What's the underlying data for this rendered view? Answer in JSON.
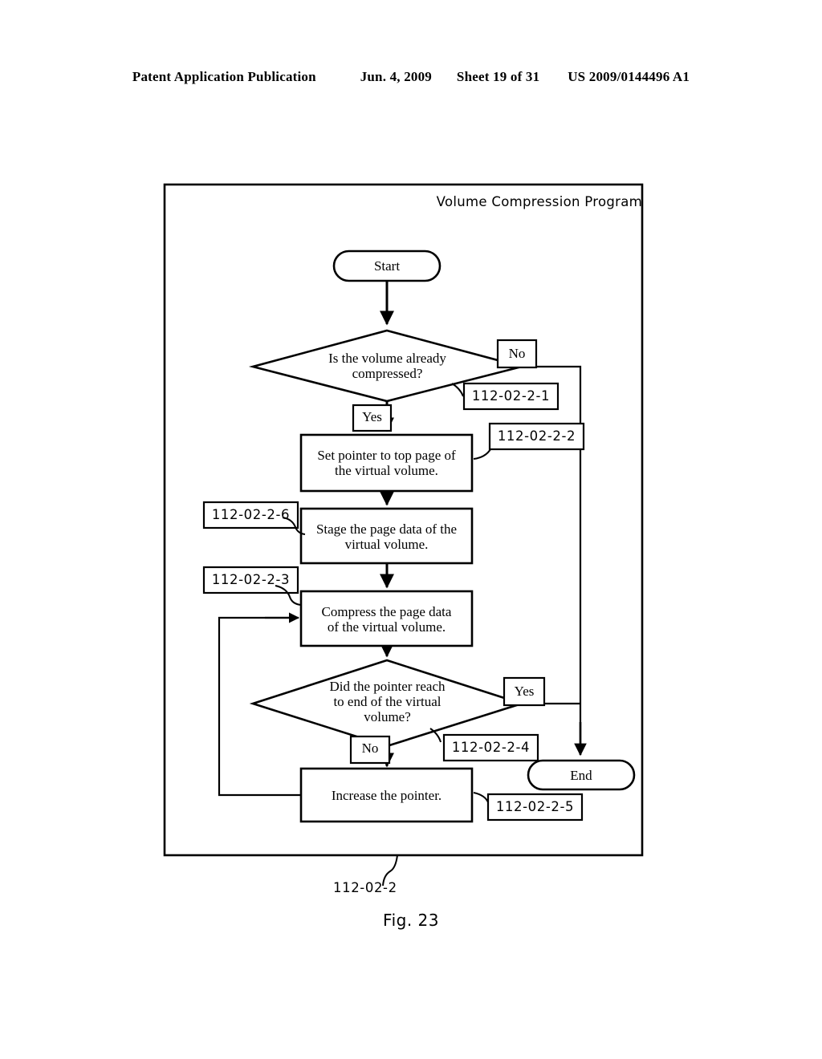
{
  "header": {
    "publication": "Patent Application Publication",
    "date": "Jun. 4, 2009",
    "sheet": "Sheet 19 of 31",
    "docnumber": "US 2009/0144496 A1"
  },
  "figure": {
    "caption": "Fig. 23",
    "container_title": "Volume Compression Program",
    "container_ref": "112-02-2"
  },
  "flow": {
    "start": "Start",
    "end": "End",
    "decision1": "Is the volume already\ncompressed?",
    "decision1_yes": "Yes",
    "decision1_no": "No",
    "decision1_ref": "112-02-2-1",
    "step_set_pointer": "Set pointer to top page of\nthe virtual volume.",
    "step_set_pointer_ref": "112-02-2-2",
    "step_stage": "Stage the page data of the\nvirtual volume.",
    "step_stage_ref": "112-02-2-6",
    "step_compress": "Compress the page data\nof the virtual volume.",
    "step_compress_ref": "112-02-2-3",
    "decision2": "Did the pointer reach\nto end of the virtual\nvolume?",
    "decision2_yes": "Yes",
    "decision2_no": "No",
    "decision2_ref": "112-02-2-4",
    "step_increase": "Increase the pointer.",
    "step_increase_ref": "112-02-2-5"
  },
  "colors": {
    "ink": "#000000",
    "paper": "#ffffff"
  }
}
